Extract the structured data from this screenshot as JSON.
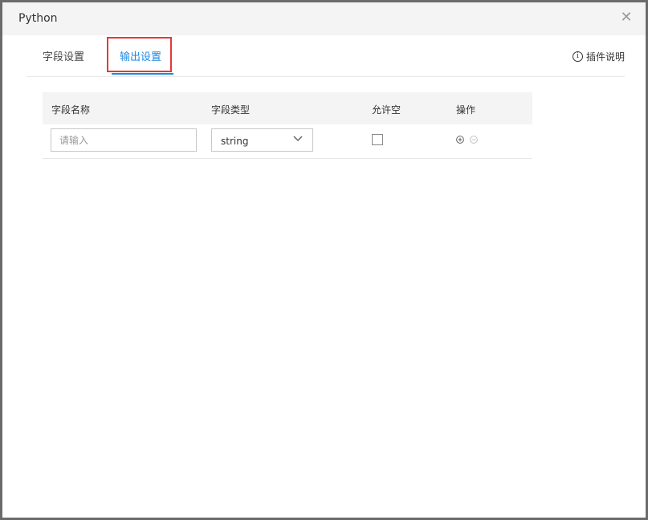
{
  "dialog": {
    "title": "Python",
    "close_icon": "close-icon"
  },
  "tabs": [
    {
      "label": "字段设置",
      "active": false
    },
    {
      "label": "输出设置",
      "active": true
    }
  ],
  "plugin_help": {
    "icon": "info-icon",
    "label": "插件说明"
  },
  "table": {
    "headers": [
      "字段名称",
      "字段类型",
      "允许空",
      "操作"
    ],
    "rows": [
      {
        "name_placeholder": "请输入",
        "name_value": "",
        "type": "string",
        "nullable": false,
        "actions": [
          "add-icon",
          "remove-icon"
        ]
      }
    ]
  },
  "colors": {
    "accent": "#1e88e5",
    "highlight": "#e53935",
    "header_bg": "#f4f4f4"
  }
}
